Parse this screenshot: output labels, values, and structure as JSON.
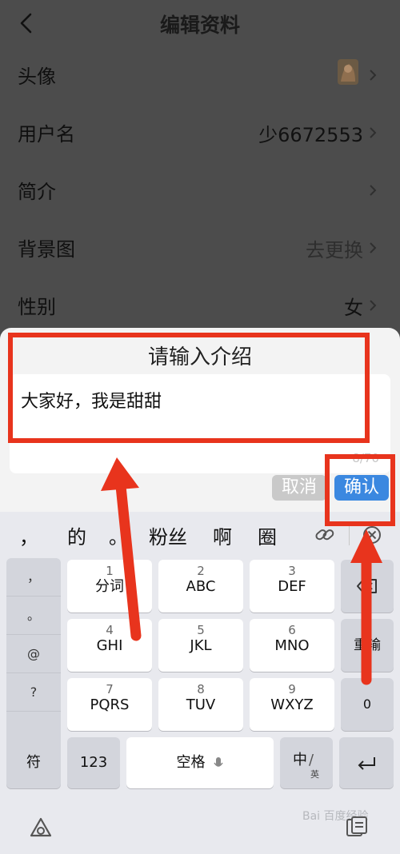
{
  "nav": {
    "title": "编辑资料"
  },
  "rows": [
    {
      "label": "头像",
      "value": ""
    },
    {
      "label": "用户名",
      "value": "少6672553"
    },
    {
      "label": "简介",
      "value": ""
    },
    {
      "label": "背景图",
      "value": "去更换"
    },
    {
      "label": "性别",
      "value": "女"
    }
  ],
  "dialog": {
    "title": "请输入介绍",
    "text": "大家好，我是甜甜",
    "count": "8/70",
    "cancel": "取消",
    "confirm": "确认"
  },
  "keyboard": {
    "candidates": [
      "，",
      "的",
      "。",
      "粉丝",
      "啊",
      "圈"
    ],
    "punct": [
      "，",
      "。",
      "@",
      "?"
    ],
    "keys": [
      {
        "num": "1",
        "label": "分词"
      },
      {
        "num": "2",
        "label": "ABC"
      },
      {
        "num": "3",
        "label": "DEF"
      },
      {
        "num": "4",
        "label": "GHI"
      },
      {
        "num": "5",
        "label": "JKL"
      },
      {
        "num": "6",
        "label": "MNO"
      },
      {
        "num": "7",
        "label": "PQRS"
      },
      {
        "num": "8",
        "label": "TUV"
      },
      {
        "num": "9",
        "label": "WXYZ"
      }
    ],
    "reenter": "重输",
    "zero": "0",
    "symbol": "符",
    "numbers": "123",
    "space": "空格",
    "lang_zh": "中",
    "lang_en": "英"
  },
  "watermark": "Bai 百度经验",
  "colors": {
    "annotation": "#e8341d",
    "confirm": "#3b88e0",
    "dim": "#4c4c4c"
  }
}
